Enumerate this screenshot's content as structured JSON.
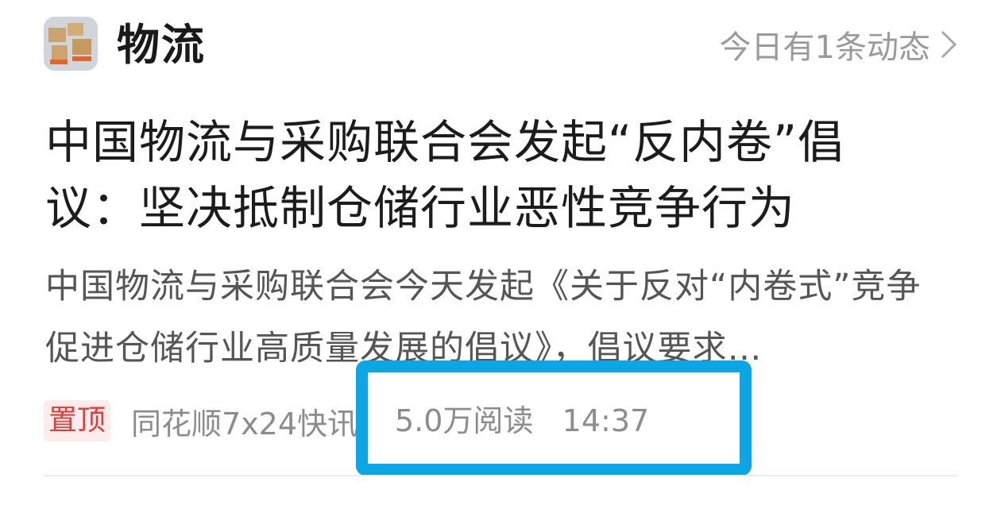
{
  "header": {
    "channel_icon": "delivery-robot-boxes-thumbnail",
    "channel_name": "物流",
    "activity_link": "今日有1条动态",
    "chevron_icon": "chevron-right-icon"
  },
  "article": {
    "title": "中国物流与采购联合会发起“反内卷”倡议：坚决抵制仓储行业恶性竞争行为",
    "summary": "中国物流与采购联合会今天发起《关于反对“内卷式”竞争促进仓储行业高质量发展的倡议》，倡议要求…",
    "pin_badge": "置顶",
    "source": "同花顺7x24快讯",
    "stats": "5.0万阅读   14:37"
  },
  "highlight_color": "#0aa6e6"
}
